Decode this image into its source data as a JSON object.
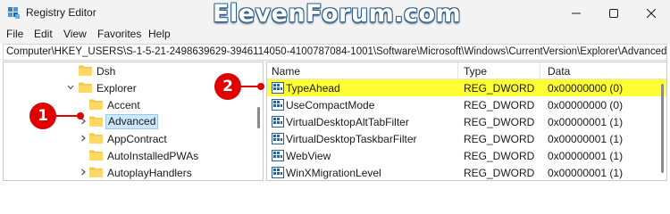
{
  "window": {
    "title": "Registry Editor",
    "watermark": "ElevenForum.com"
  },
  "menu": [
    "File",
    "Edit",
    "View",
    "Favorites",
    "Help"
  ],
  "address": "Computer\\HKEY_USERS\\S-1-5-21-2498639629-3946114050-4100787084-1001\\Software\\Microsoft\\Windows\\CurrentVersion\\Explorer\\Advanced",
  "tree": [
    {
      "label": "Dsh",
      "chevron": "none",
      "level": 1
    },
    {
      "label": "Explorer",
      "chevron": "down",
      "level": 0
    },
    {
      "label": "Accent",
      "chevron": "none",
      "level": 2
    },
    {
      "label": "Advanced",
      "chevron": "right",
      "level": 2,
      "selected": true
    },
    {
      "label": "AppContract",
      "chevron": "right",
      "level": 2
    },
    {
      "label": "AutoInstalledPWAs",
      "chevron": "none",
      "level": 2
    },
    {
      "label": "AutoplayHandlers",
      "chevron": "right",
      "level": 2
    }
  ],
  "list": {
    "columns": [
      "Name",
      "Type",
      "Data"
    ],
    "rows": [
      {
        "name": "TypeAhead",
        "type": "REG_DWORD",
        "data": "0x00000000 (0)",
        "highlight": true
      },
      {
        "name": "UseCompactMode",
        "type": "REG_DWORD",
        "data": "0x00000000 (0)"
      },
      {
        "name": "VirtualDesktopAltTabFilter",
        "type": "REG_DWORD",
        "data": "0x00000001 (1)"
      },
      {
        "name": "VirtualDesktopTaskbarFilter",
        "type": "REG_DWORD",
        "data": "0x00000001 (1)"
      },
      {
        "name": "WebView",
        "type": "REG_DWORD",
        "data": "0x00000001 (1)"
      },
      {
        "name": "WinXMigrationLevel",
        "type": "REG_DWORD",
        "data": "0x00000001 (1)"
      }
    ]
  },
  "callouts": [
    "1",
    "2"
  ],
  "colors": {
    "highlight": "#ffff33",
    "callout": "#e10000",
    "selection": "#cce8ff"
  },
  "icons": {
    "app": "registry-icon",
    "folder": "folder-icon",
    "value": "dword-value-icon"
  }
}
